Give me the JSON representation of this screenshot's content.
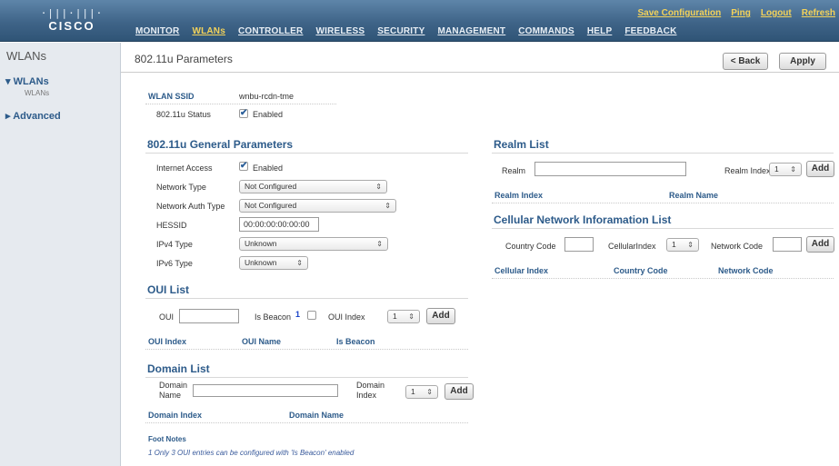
{
  "header": {
    "logo_bars": "·|||·|||·",
    "logo_word": "CISCO",
    "top_links": [
      "Save Configuration",
      "Ping",
      "Logout",
      "Refresh"
    ],
    "nav": [
      "MONITOR",
      "WLANs",
      "CONTROLLER",
      "WIRELESS",
      "SECURITY",
      "MANAGEMENT",
      "COMMANDS",
      "HELP",
      "FEEDBACK"
    ],
    "active_nav": "WLANs"
  },
  "sidebar": {
    "title": "WLANs",
    "wlans_label": "WLANs",
    "wlans_sub": "WLANs",
    "advanced_label": "Advanced",
    "wlans_arrow": "▾",
    "advanced_arrow": "▸"
  },
  "page": {
    "title": "802.11u Parameters",
    "back_button": "< Back",
    "apply_button": "Apply"
  },
  "wlan": {
    "ssid_label": "WLAN SSID",
    "ssid_value": "wnbu-rcdn-tme",
    "status_label": "802.11u Status",
    "status_value": "Enabled"
  },
  "general": {
    "title": "802.11u General Parameters",
    "internet_access_label": "Internet Access",
    "internet_access_value": "Enabled",
    "network_type_label": "Network Type",
    "network_type_value": "Not Configured",
    "network_auth_label": "Network Auth Type",
    "network_auth_value": "Not Configured",
    "hessid_label": "HESSID",
    "hessid_value": "00:00:00:00:00:00",
    "ipv4_label": "IPv4 Type",
    "ipv4_value": "Unknown",
    "ipv6_label": "IPv6 Type",
    "ipv6_value": "Unknown"
  },
  "oui": {
    "title": "OUI List",
    "oui_label": "OUI",
    "is_beacon_label": "Is Beacon",
    "footnote_marker": "1",
    "index_label": "OUI Index",
    "index_value": "1",
    "add_button": "Add",
    "columns": [
      "OUI Index",
      "OUI Name",
      "Is Beacon"
    ]
  },
  "domain": {
    "title": "Domain List",
    "name_label_line1": "Domain",
    "name_label_line2": "Name",
    "index_label_line1": "Domain",
    "index_label_line2": "Index",
    "index_value": "1",
    "add_button": "Add",
    "columns": [
      "Domain Index",
      "Domain Name"
    ]
  },
  "footnotes": {
    "title": "Foot Notes",
    "note1": "1 Only 3 OUI entries can be configured with 'Is Beacon' enabled"
  },
  "realm": {
    "title": "Realm List",
    "realm_label": "Realm",
    "index_label": "Realm Index",
    "index_value": "1",
    "add_button": "Add",
    "columns": [
      "Realm Index",
      "Realm Name"
    ]
  },
  "cellular": {
    "title": "Cellular Network Inforamation List",
    "country_label": "Country Code",
    "cell_index_label": "CellularIndex",
    "cell_index_value": "1",
    "network_code_label": "Network Code",
    "add_button": "Add",
    "columns": [
      "Cellular Index",
      "Country Code",
      "Network Code"
    ]
  },
  "icons": {
    "select_arrow": "⇕",
    "checkmark": "✔"
  },
  "colors": {
    "header_bg": "#3f6488",
    "nav_active": "#f3d25a",
    "section_blue": "#2d5b8a",
    "sidebar_bg": "#e6eaef"
  }
}
